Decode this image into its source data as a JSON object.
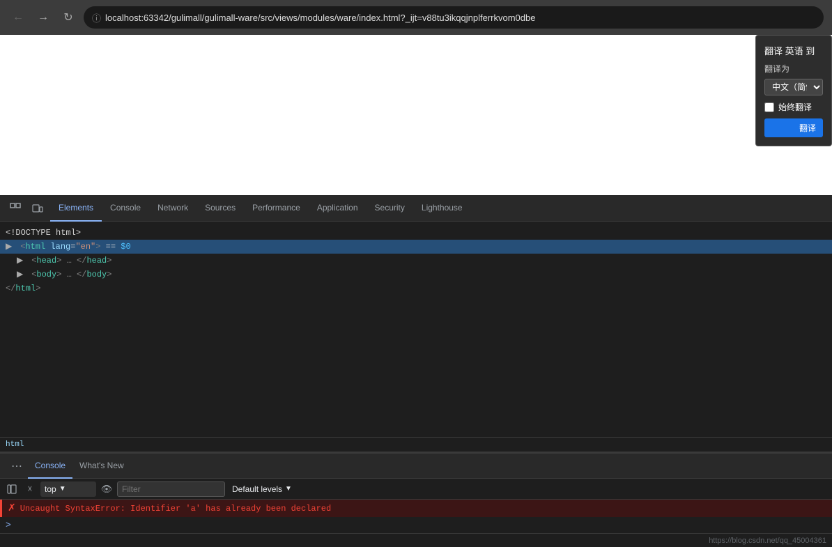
{
  "browser": {
    "url": "localhost:63342/gulimall/gulimall-ware/src/views/modules/ware/index.html?_ijt=v88tu3ikqqjnplferrkvom0dbe",
    "back_title": "Back",
    "forward_title": "Forward",
    "reload_title": "Reload"
  },
  "translate_popup": {
    "title": "翻译 英语 到",
    "label": "翻译为",
    "lang_value": "中文（简体",
    "always_label": "始终翻译",
    "translate_btn": "翻译"
  },
  "devtools": {
    "tabs": [
      {
        "label": "Elements",
        "active": true
      },
      {
        "label": "Console",
        "active": false
      },
      {
        "label": "Network",
        "active": false
      },
      {
        "label": "Sources",
        "active": false
      },
      {
        "label": "Performance",
        "active": false
      },
      {
        "label": "Application",
        "active": false
      },
      {
        "label": "Security",
        "active": false
      },
      {
        "label": "Lighthouse",
        "active": false
      }
    ],
    "html_lines": [
      {
        "indent": 0,
        "text": "<!DOCTYPE html>",
        "type": "comment"
      },
      {
        "indent": 0,
        "text": "<html lang=\"en\"> == $0",
        "selected": true
      },
      {
        "indent": 1,
        "text": "<head>…</head>"
      },
      {
        "indent": 1,
        "text": "<body>…</body>"
      },
      {
        "indent": 0,
        "text": "</html>"
      }
    ],
    "breadcrumb": "html"
  },
  "console": {
    "tabs": [
      {
        "label": "Console",
        "active": true
      },
      {
        "label": "What's New",
        "active": false
      }
    ],
    "context": "top",
    "filter_placeholder": "Filter",
    "levels_label": "Default levels",
    "error_message": "Uncaught SyntaxError: Identifier 'a' has already been declared",
    "prompt": ">"
  },
  "bottom_bar": {
    "link_text": "https://blog.csdn.net/qq_45004361"
  }
}
